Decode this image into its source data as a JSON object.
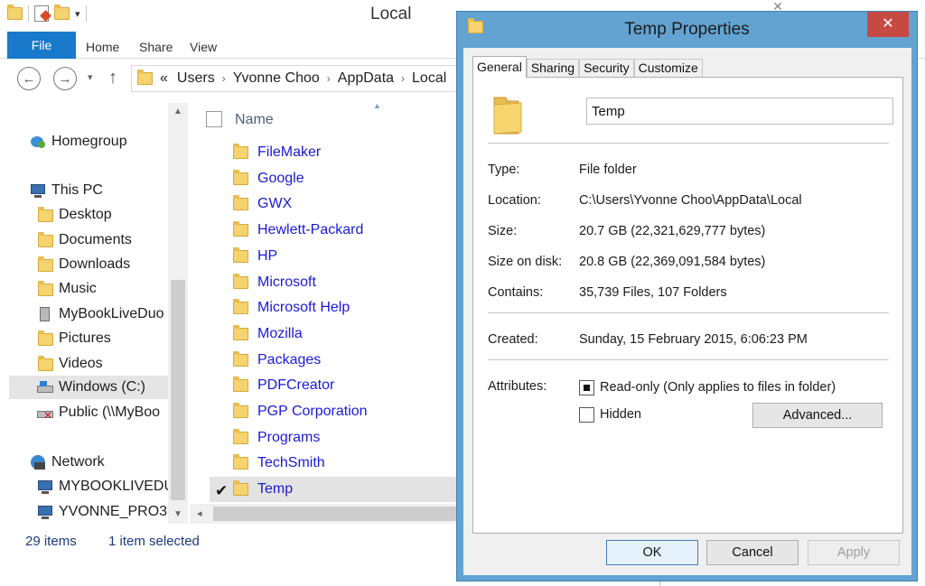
{
  "explorer": {
    "title": "Local",
    "close_glyph": "✕",
    "ribbon_tabs": {
      "file": "File",
      "home": "Home",
      "share": "Share",
      "view": "View"
    },
    "address": [
      "«",
      "Users",
      "Yvonne Choo",
      "AppData",
      "Local"
    ],
    "nav_icons": {
      "back": "←",
      "forward": "→",
      "recent": "▾",
      "up": "↑"
    },
    "nav": {
      "homegroup": "Homegroup",
      "this_pc": "This PC",
      "desktop": "Desktop",
      "documents": "Documents",
      "downloads": "Downloads",
      "music": "Music",
      "mybooklive": "MyBookLiveDuo",
      "pictures": "Pictures",
      "videos": "Videos",
      "windows_c": "Windows (C:)",
      "public": "Public (\\\\MyBoo",
      "network": "Network",
      "mybooklivedu": "MYBOOKLIVEDU",
      "yvonne_pro3": "YVONNE_PRO3"
    },
    "column_header": "Name",
    "files": [
      "FileMaker",
      "Google",
      "GWX",
      "Hewlett-Packard",
      "HP",
      "Microsoft",
      "Microsoft Help",
      "Mozilla",
      "Packages",
      "PDFCreator",
      "PGP Corporation",
      "Programs",
      "TechSmith",
      "Temp"
    ],
    "selected_file": "Temp",
    "check_glyph": "✔",
    "status": {
      "items": "29 items",
      "selected": "1 item selected"
    }
  },
  "dialog": {
    "title": "Temp Properties",
    "close_glyph": "✕",
    "tabs": [
      "General",
      "Sharing",
      "Security",
      "Customize"
    ],
    "active_tab": "General",
    "name_value": "Temp",
    "props": {
      "type_label": "Type:",
      "type_value": "File folder",
      "location_label": "Location:",
      "location_value": "C:\\Users\\Yvonne Choo\\AppData\\Local",
      "size_label": "Size:",
      "size_value": "20.7 GB (22,321,629,777 bytes)",
      "size_on_disk_label": "Size on disk:",
      "size_on_disk_value": "20.8 GB (22,369,091,584 bytes)",
      "contains_label": "Contains:",
      "contains_value": "35,739 Files, 107 Folders",
      "created_label": "Created:",
      "created_value": "Sunday, 15 February 2015, 6:06:23 PM",
      "attributes_label": "Attributes:"
    },
    "readonly_label": "Read-only (Only applies to files in folder)",
    "readonly_state": "indeterminate",
    "hidden_label": "Hidden",
    "hidden_checked": false,
    "buttons": {
      "advanced": "Advanced...",
      "ok": "OK",
      "cancel": "Cancel",
      "apply": "Apply"
    }
  },
  "colors": {
    "accent": "#1979ca",
    "dialog_frame": "#62a3d2",
    "close_red": "#c74a42",
    "link_blue": "#1a1ad6",
    "folder_yellow": "#f5d36e"
  }
}
